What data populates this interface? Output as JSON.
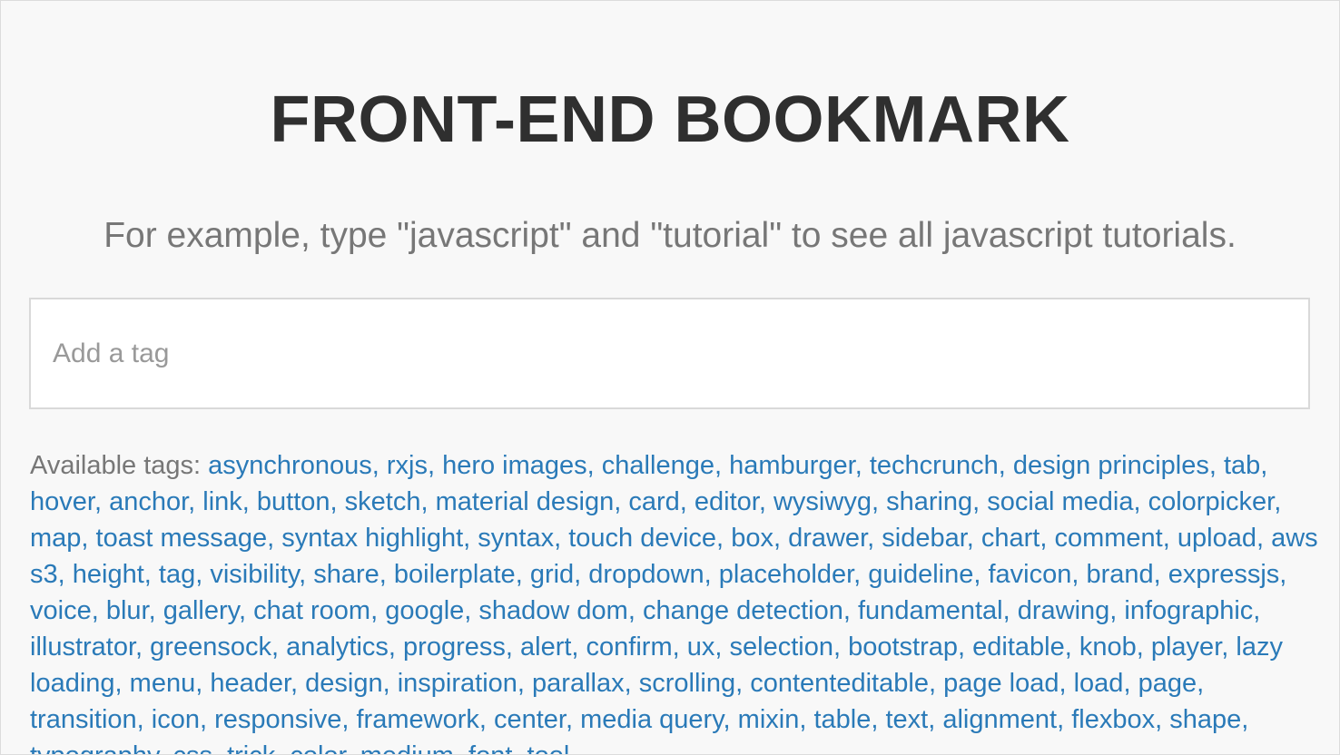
{
  "header": {
    "title": "FRONT-END BOOKMARK",
    "subtitle": "For example, type \"javascript\" and \"tutorial\" to see all javascript tutorials."
  },
  "search": {
    "placeholder": "Add a tag",
    "value": ""
  },
  "tags_section": {
    "label": "Available tags:",
    "tags": [
      "asynchronous",
      "rxjs",
      "hero images",
      "challenge",
      "hamburger",
      "techcrunch",
      "design principles",
      "tab",
      "hover",
      "anchor",
      "link",
      "button",
      "sketch",
      "material design",
      "card",
      "editor",
      "wysiwyg",
      "sharing",
      "social media",
      "colorpicker",
      "map",
      "toast message",
      "syntax highlight",
      "syntax",
      "touch device",
      "box",
      "drawer",
      "sidebar",
      "chart",
      "comment",
      "upload",
      "aws s3",
      "height",
      "tag",
      "visibility",
      "share",
      "boilerplate",
      "grid",
      "dropdown",
      "placeholder",
      "guideline",
      "favicon",
      "brand",
      "expressjs",
      "voice",
      "blur",
      "gallery",
      "chat room",
      "google",
      "shadow dom",
      "change detection",
      "fundamental",
      "drawing",
      "infographic",
      "illustrator",
      "greensock",
      "analytics",
      "progress",
      "alert",
      "confirm",
      "ux",
      "selection",
      "bootstrap",
      "editable",
      "knob",
      "player",
      "lazy loading",
      "menu",
      "header",
      "design",
      "inspiration",
      "parallax",
      "scrolling",
      "contenteditable",
      "page load",
      "load",
      "page",
      "transition",
      "icon",
      "responsive",
      "framework",
      "center",
      "media query",
      "mixin",
      "table",
      "text",
      "alignment",
      "flexbox",
      "shape",
      "typography",
      "css",
      "trick",
      "color",
      "medium",
      "font",
      "tool"
    ]
  },
  "colors": {
    "background": "#f8f8f8",
    "title": "#2f2f2f",
    "subtitle": "#777777",
    "link": "#2a7ab8"
  }
}
